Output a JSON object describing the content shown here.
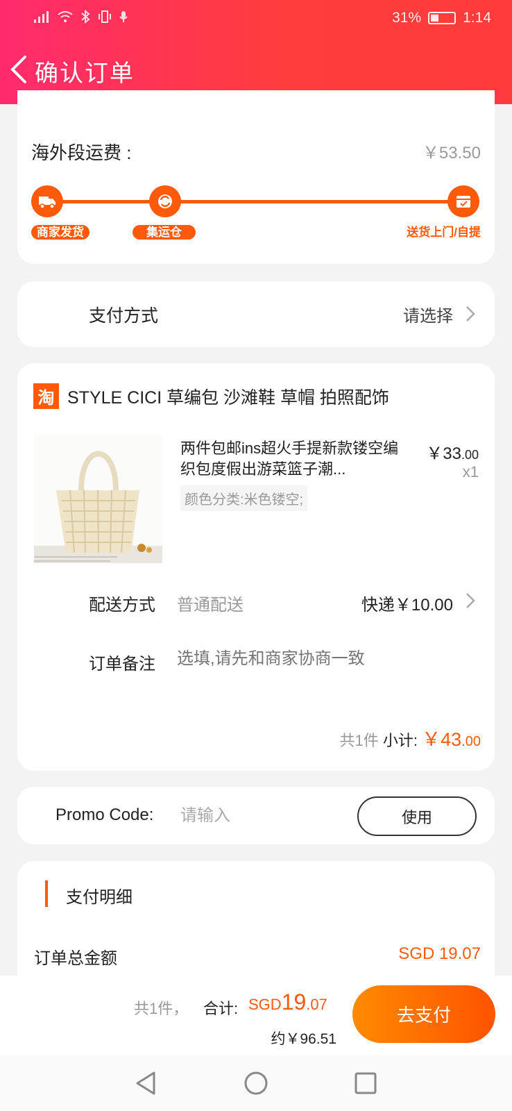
{
  "status_bar": {
    "battery": "31%",
    "time": "1:14"
  },
  "header": {
    "title": "确认订单"
  },
  "shipping": {
    "fee_label": "海外段运费 :",
    "fee_value": "￥53.50",
    "steps": [
      "商家发货",
      "集运仓",
      "送货上门/自提"
    ]
  },
  "payment": {
    "label": "支付方式",
    "value": "请选择"
  },
  "order": {
    "shop_logo": "淘",
    "shop_name": "STYLE CICI 草编包 沙滩鞋 草帽 拍照配饰",
    "product": {
      "title": "两件包邮ins超火手提新款镂空编织包度假出游菜篮子潮...",
      "spec": "颜色分类:米色镂空;",
      "price_main": "￥33",
      "price_cents": ".00",
      "qty": "x1"
    },
    "delivery": {
      "label": "配送方式",
      "type": "普通配送",
      "fee": "快递￥10.00"
    },
    "note": {
      "label": "订单备注",
      "placeholder": "选填,请先和商家协商一致"
    },
    "subtotal": {
      "count": "共1件",
      "label": "小计:",
      "amount_main": "￥43",
      "amount_cents": ".00"
    }
  },
  "promo": {
    "label": "Promo Code:",
    "placeholder": "请输入",
    "button": "使用"
  },
  "detail": {
    "title": "支付明细",
    "total_label": "订单总金额",
    "total_value": "SGD 19.07"
  },
  "checkout": {
    "count": "共1件，",
    "sum_label": "合计:",
    "currency": "SGD",
    "sum_main": "19",
    "sum_cents": ".07",
    "approx": "约￥96.51",
    "pay_button": "去支付"
  },
  "colors": {
    "accent": "#ff5a0a",
    "header_start": "#ff2a6d",
    "header_end": "#ff3b3b"
  }
}
